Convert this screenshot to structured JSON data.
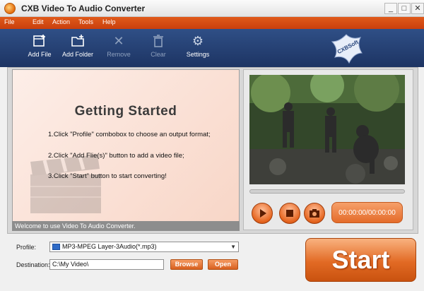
{
  "window": {
    "title": "CXB Video To Audio Converter",
    "minimize": "_",
    "maximize": "□",
    "close": "✕"
  },
  "menu": {
    "items": [
      "File",
      "Edit",
      "Action",
      "Tools",
      "Help"
    ]
  },
  "toolbar": {
    "items": [
      {
        "label": "Add File",
        "icon": "add-file-icon",
        "enabled": true
      },
      {
        "label": "Add Folder",
        "icon": "add-folder-icon",
        "enabled": true
      },
      {
        "label": "Remove",
        "icon": "remove-icon",
        "enabled": false
      },
      {
        "label": "Clear",
        "icon": "trash-icon",
        "enabled": false
      },
      {
        "label": "Settings",
        "icon": "settings-gear-icon",
        "enabled": true
      }
    ],
    "logo_text": "CXBSoft"
  },
  "getting_started": {
    "title": "Getting  Started",
    "steps": [
      "1.Click \"Profile\" combobox to choose an output format;",
      "2.Click \"Add Flie(s)\" button to add a video file;",
      "3.Click \"Start\" button to start converting!"
    ]
  },
  "status": {
    "text": "Welcome to use Video To Audio Converter."
  },
  "player": {
    "time": "00:00:00/00:00:00",
    "progress": 0
  },
  "profile": {
    "label": "Profile:",
    "value": "MP3-MPEG Layer-3Audio(*.mp3)"
  },
  "destination": {
    "label": "Destination:",
    "value": "C:\\My Video\\",
    "browse_label": "Browse",
    "open_label": "Open"
  },
  "start": {
    "label": "Start"
  },
  "colors": {
    "accent_orange": "#e46b2a",
    "toolbar_blue": "#24427a"
  }
}
